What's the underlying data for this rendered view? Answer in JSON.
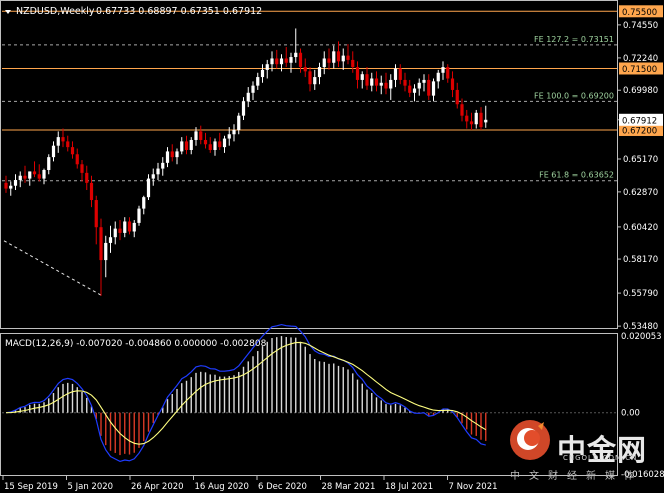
{
  "chart_data": {
    "type": "candlestick",
    "symbol": "NZDUSD,Weekly",
    "ohlc_header": [
      "0.67733",
      "0.68897",
      "0.67351",
      "0.67912"
    ],
    "price_axis": {
      "ticks": [
        "0.74550",
        "0.72240",
        "0.69980",
        "0.67912",
        "0.65170",
        "0.62870",
        "0.60420",
        "0.58170",
        "0.55790",
        "0.53480"
      ],
      "range": [
        0.5335,
        0.7615
      ]
    },
    "x_labels": [
      "15 Sep 2019",
      "5 Jan 2020",
      "26 Apr 2020",
      "16 Aug 2020",
      "6 Dec 2020",
      "28 Mar 2021",
      "18 Jul 2021",
      "7 Nov 2021"
    ],
    "current_price": "0.67912",
    "horizontal_levels": [
      {
        "label": "0.75500",
        "value": 0.755,
        "kind": "support-resistance",
        "color": "#ffa64d"
      },
      {
        "label": "0.71500",
        "value": 0.715,
        "kind": "support-resistance",
        "color": "#ffa64d"
      },
      {
        "label": "0.67200",
        "value": 0.672,
        "kind": "support-resistance",
        "color": "#ffa64d"
      }
    ],
    "fib_levels": [
      {
        "text": "FE 127.2 = 0.73151",
        "value": 0.73151
      },
      {
        "text": "FE 100.0 = 0.69200",
        "value": 0.692
      },
      {
        "text": "FE 61.8 = 0.63652",
        "value": 0.63652
      }
    ],
    "trendline": {
      "from": {
        "date": "2019-08-04",
        "price": 0.5945
      },
      "to": {
        "date": "2020-03-15",
        "price": 0.5565
      }
    },
    "candles": [
      [
        0.635,
        0.64,
        0.628,
        0.631
      ],
      [
        0.631,
        0.636,
        0.626,
        0.633
      ],
      [
        0.633,
        0.641,
        0.63,
        0.637
      ],
      [
        0.637,
        0.643,
        0.632,
        0.64
      ],
      [
        0.64,
        0.647,
        0.635,
        0.638
      ],
      [
        0.638,
        0.643,
        0.633,
        0.643
      ],
      [
        0.643,
        0.65,
        0.639,
        0.641
      ],
      [
        0.641,
        0.648,
        0.636,
        0.638
      ],
      [
        0.638,
        0.645,
        0.634,
        0.644
      ],
      [
        0.644,
        0.655,
        0.641,
        0.653
      ],
      [
        0.653,
        0.664,
        0.65,
        0.661
      ],
      [
        0.661,
        0.671,
        0.656,
        0.667
      ],
      [
        0.667,
        0.673,
        0.66,
        0.664
      ],
      [
        0.664,
        0.668,
        0.657,
        0.66
      ],
      [
        0.66,
        0.664,
        0.652,
        0.655
      ],
      [
        0.655,
        0.659,
        0.645,
        0.648
      ],
      [
        0.648,
        0.651,
        0.636,
        0.642
      ],
      [
        0.642,
        0.647,
        0.63,
        0.635
      ],
      [
        0.635,
        0.64,
        0.618,
        0.623
      ],
      [
        0.623,
        0.626,
        0.592,
        0.604
      ],
      [
        0.604,
        0.61,
        0.556,
        0.581
      ],
      [
        0.581,
        0.598,
        0.569,
        0.593
      ],
      [
        0.593,
        0.605,
        0.586,
        0.597
      ],
      [
        0.597,
        0.608,
        0.592,
        0.603
      ],
      [
        0.603,
        0.609,
        0.595,
        0.6
      ],
      [
        0.6,
        0.611,
        0.597,
        0.608
      ],
      [
        0.608,
        0.611,
        0.599,
        0.601
      ],
      [
        0.601,
        0.609,
        0.597,
        0.607
      ],
      [
        0.607,
        0.619,
        0.605,
        0.617
      ],
      [
        0.617,
        0.626,
        0.613,
        0.625
      ],
      [
        0.625,
        0.641,
        0.623,
        0.638
      ],
      [
        0.638,
        0.645,
        0.633,
        0.641
      ],
      [
        0.641,
        0.649,
        0.637,
        0.645
      ],
      [
        0.645,
        0.653,
        0.64,
        0.649
      ],
      [
        0.649,
        0.66,
        0.646,
        0.657
      ],
      [
        0.657,
        0.662,
        0.65,
        0.653
      ],
      [
        0.653,
        0.659,
        0.648,
        0.657
      ],
      [
        0.657,
        0.667,
        0.655,
        0.664
      ],
      [
        0.664,
        0.668,
        0.655,
        0.658
      ],
      [
        0.658,
        0.667,
        0.655,
        0.665
      ],
      [
        0.665,
        0.674,
        0.661,
        0.671
      ],
      [
        0.671,
        0.675,
        0.662,
        0.665
      ],
      [
        0.665,
        0.67,
        0.659,
        0.662
      ],
      [
        0.662,
        0.667,
        0.656,
        0.658
      ],
      [
        0.658,
        0.666,
        0.654,
        0.664
      ],
      [
        0.664,
        0.67,
        0.658,
        0.66
      ],
      [
        0.66,
        0.668,
        0.656,
        0.666
      ],
      [
        0.666,
        0.674,
        0.661,
        0.669
      ],
      [
        0.669,
        0.676,
        0.664,
        0.672
      ],
      [
        0.672,
        0.684,
        0.669,
        0.682
      ],
      [
        0.682,
        0.695,
        0.679,
        0.692
      ],
      [
        0.692,
        0.702,
        0.688,
        0.698
      ],
      [
        0.698,
        0.706,
        0.693,
        0.703
      ],
      [
        0.703,
        0.712,
        0.7,
        0.709
      ],
      [
        0.709,
        0.718,
        0.705,
        0.714
      ],
      [
        0.714,
        0.721,
        0.708,
        0.718
      ],
      [
        0.718,
        0.727,
        0.713,
        0.722
      ],
      [
        0.722,
        0.728,
        0.715,
        0.718
      ],
      [
        0.718,
        0.725,
        0.713,
        0.722
      ],
      [
        0.722,
        0.73,
        0.716,
        0.719
      ],
      [
        0.719,
        0.726,
        0.712,
        0.723
      ],
      [
        0.723,
        0.743,
        0.719,
        0.726
      ],
      [
        0.726,
        0.729,
        0.712,
        0.716
      ],
      [
        0.716,
        0.722,
        0.709,
        0.713
      ],
      [
        0.713,
        0.716,
        0.699,
        0.704
      ],
      [
        0.704,
        0.714,
        0.7,
        0.709
      ],
      [
        0.709,
        0.719,
        0.704,
        0.716
      ],
      [
        0.716,
        0.727,
        0.711,
        0.722
      ],
      [
        0.722,
        0.729,
        0.714,
        0.719
      ],
      [
        0.719,
        0.731,
        0.715,
        0.727
      ],
      [
        0.727,
        0.734,
        0.716,
        0.72
      ],
      [
        0.72,
        0.729,
        0.714,
        0.724
      ],
      [
        0.724,
        0.732,
        0.718,
        0.721
      ],
      [
        0.721,
        0.727,
        0.712,
        0.716
      ],
      [
        0.716,
        0.72,
        0.701,
        0.707
      ],
      [
        0.707,
        0.713,
        0.701,
        0.711
      ],
      [
        0.711,
        0.716,
        0.7,
        0.703
      ],
      [
        0.703,
        0.712,
        0.699,
        0.708
      ],
      [
        0.708,
        0.713,
        0.699,
        0.703
      ],
      [
        0.703,
        0.71,
        0.697,
        0.705
      ],
      [
        0.705,
        0.712,
        0.697,
        0.701
      ],
      [
        0.701,
        0.711,
        0.693,
        0.707
      ],
      [
        0.707,
        0.718,
        0.702,
        0.715
      ],
      [
        0.715,
        0.718,
        0.704,
        0.707
      ],
      [
        0.707,
        0.712,
        0.699,
        0.703
      ],
      [
        0.703,
        0.707,
        0.695,
        0.698
      ],
      [
        0.698,
        0.704,
        0.692,
        0.701
      ],
      [
        0.701,
        0.708,
        0.696,
        0.705
      ],
      [
        0.705,
        0.711,
        0.699,
        0.707
      ],
      [
        0.707,
        0.711,
        0.693,
        0.696
      ],
      [
        0.696,
        0.708,
        0.692,
        0.706
      ],
      [
        0.706,
        0.714,
        0.701,
        0.712
      ],
      [
        0.712,
        0.72,
        0.707,
        0.716
      ],
      [
        0.716,
        0.718,
        0.705,
        0.708
      ],
      [
        0.708,
        0.713,
        0.695,
        0.7
      ],
      [
        0.7,
        0.705,
        0.687,
        0.69
      ],
      [
        0.69,
        0.694,
        0.678,
        0.682
      ],
      [
        0.682,
        0.686,
        0.673,
        0.678
      ],
      [
        0.678,
        0.684,
        0.672,
        0.676
      ],
      [
        0.676,
        0.686,
        0.673,
        0.684
      ],
      [
        0.684,
        0.688,
        0.672,
        0.674
      ],
      [
        0.6773,
        0.68897,
        0.67351,
        0.67912
      ]
    ],
    "macd": {
      "label": "MACD(12,26,9) -0.007020 -0.004860 0.000000 -0.002808",
      "params": [
        12,
        26,
        9
      ],
      "values": [
        -0.00702,
        -0.00486,
        0.0,
        -0.002808
      ],
      "ticks": [
        "0.020053",
        "0.00",
        "-0.016028"
      ],
      "range": [
        -0.016028,
        0.020053
      ],
      "zero_line": 0.0,
      "histogram_up_color": "#dcdcdc",
      "histogram_down_color": "#d93a26",
      "main_color": "#1f3cff",
      "signal_color": "#ffff80"
    }
  },
  "watermark": {
    "logo": "中金网",
    "url": "CNGOLD.COM.CN",
    "subtitle": "中文财经新媒体"
  },
  "colors": {
    "background": "#000000",
    "bull": "#ffffff",
    "bear": "#dd0000",
    "level": "#ffa64d",
    "fib": "#9a9a9a",
    "grid_axis": "#bfbfbf"
  }
}
